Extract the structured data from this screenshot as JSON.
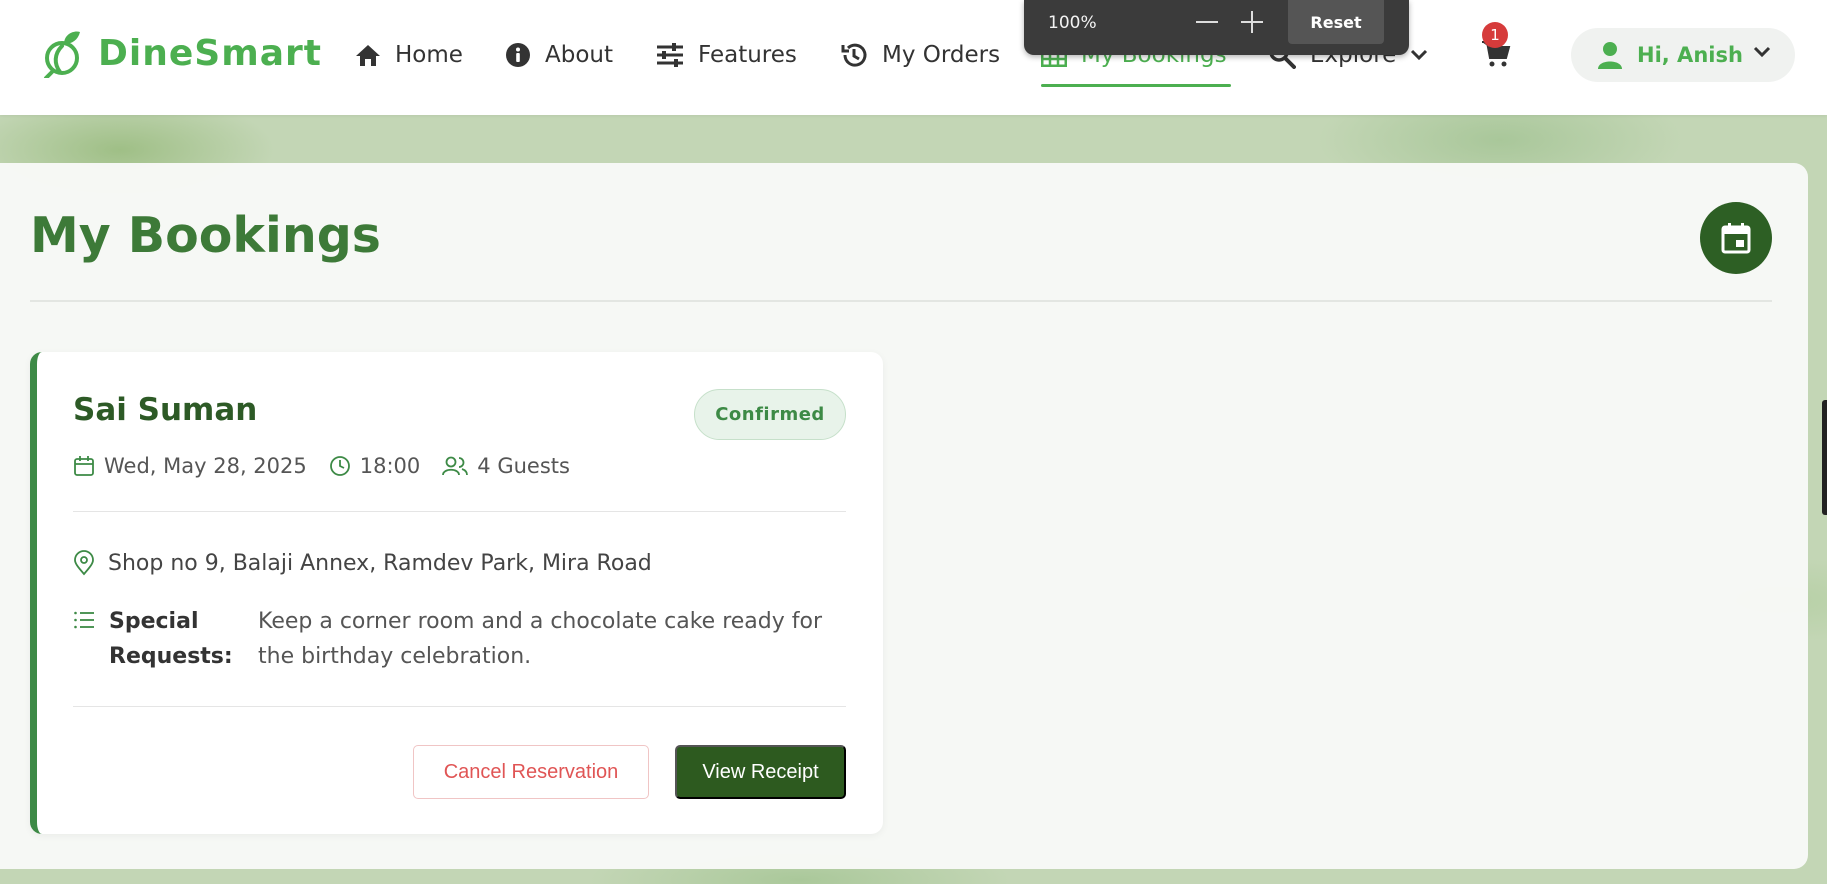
{
  "brand": {
    "name": "DineSmart"
  },
  "nav": {
    "items": [
      {
        "label": "Home",
        "icon": "home-icon"
      },
      {
        "label": "About",
        "icon": "info-icon"
      },
      {
        "label": "Features",
        "icon": "sliders-icon"
      },
      {
        "label": "My Orders",
        "icon": "history-icon"
      },
      {
        "label": "My Bookings",
        "icon": "grid-icon",
        "active": true
      },
      {
        "label": "Explore",
        "icon": "search-icon"
      }
    ],
    "cart_count": "1",
    "user_greeting": "Hi, Anish"
  },
  "zoom": {
    "value": "100%",
    "reset_label": "Reset"
  },
  "page": {
    "title": "My Bookings"
  },
  "booking": {
    "restaurant": "Sai Suman",
    "status": "Confirmed",
    "date": "Wed, May 28, 2025",
    "time": "18:00",
    "guests": "4 Guests",
    "address": "Shop no 9, Balaji Annex, Ramdev Park, Mira Road",
    "special_requests_label": "Special Requests:",
    "special_requests": "Keep a corner room and a chocolate cake ready for the birthday celebration.",
    "cancel_label": "Cancel Reservation",
    "receipt_label": "View Receipt"
  },
  "colors": {
    "brand_green": "#4caf50",
    "dark_green": "#2d5a1f",
    "title_green": "#3d7a38",
    "cancel_red": "#e05555",
    "badge_red": "#d63b3b"
  }
}
